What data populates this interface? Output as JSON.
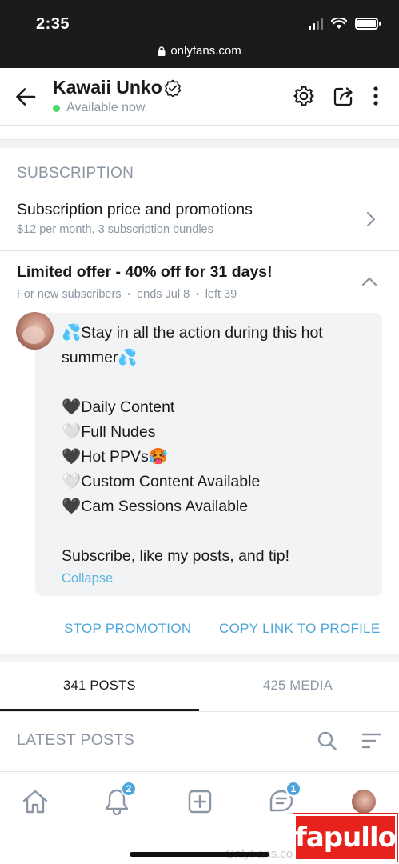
{
  "status_bar": {
    "time": "2:35",
    "url": "onlyfans.com"
  },
  "header": {
    "name": "Kawaii Unko",
    "availability": "Available now"
  },
  "subscription": {
    "section_title": "SUBSCRIPTION",
    "row_title": "Subscription price and promotions",
    "row_subtitle": "$12 per month, 3 subscription bundles"
  },
  "offer": {
    "title": "Limited offer - 40% off for 31 days!",
    "audience": "For new subscribers",
    "ends": "ends Jul 8",
    "left": "left 39",
    "message_lines": [
      "💦Stay in all the action during this hot",
      "summer💦",
      "",
      "🖤Daily Content",
      "🤍Full Nudes",
      "🖤Hot PPVs🥵",
      "🤍Custom Content Available",
      "🖤Cam Sessions Available",
      "",
      "Subscribe, like my posts, and tip!"
    ],
    "collapse_label": "Collapse",
    "stop_promotion": "STOP PROMOTION",
    "copy_link": "COPY LINK TO PROFILE"
  },
  "tabs": {
    "posts": "341 POSTS",
    "media": "425 MEDIA"
  },
  "latest": {
    "title": "LATEST POSTS"
  },
  "bottom_nav": {
    "notifications_badge": "2",
    "messages_badge": "1",
    "watermark": "OnlyFans.com",
    "logo_text": "fapullo"
  },
  "colors": {
    "accent": "#4ea5d9",
    "online": "#4cd964",
    "muted": "#8a96a3"
  }
}
